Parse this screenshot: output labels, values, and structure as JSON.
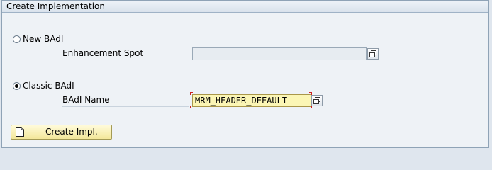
{
  "group": {
    "title": "Create Implementation"
  },
  "options": {
    "new_badi": {
      "label": "New BAdI",
      "selected": false
    },
    "classic_badi": {
      "label": "Classic BAdI",
      "selected": true
    }
  },
  "fields": {
    "enhancement_spot": {
      "label": "Enhancement Spot",
      "value": ""
    },
    "badi_name": {
      "label": "BAdI Name",
      "value": "MRM_HEADER_DEFAULT"
    }
  },
  "button": {
    "label": "Create Impl."
  },
  "icons": {
    "value_help": "value-help-icon",
    "create": "blank-document-icon"
  }
}
